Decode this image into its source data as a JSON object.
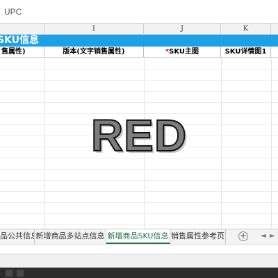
{
  "formula_bar": {
    "text": "UPC"
  },
  "columns": [
    "I",
    "J",
    "K"
  ],
  "banner": {
    "title": "SKU信息"
  },
  "fields": {
    "left_partial": "售属性)",
    "version": "版本(文字销售属性)",
    "sku_main_image_required": "*",
    "sku_main_image": "SKU主图",
    "sku_detail_image": "SKU详情图1"
  },
  "overlay_text": "RED",
  "sheet_tabs": [
    {
      "label": "品公共信息",
      "active": false
    },
    {
      "label": "新增商品多站点信息",
      "active": false
    },
    {
      "label": "新增商品SKU信息",
      "active": true
    },
    {
      "label": "销售属性参考页",
      "active": false
    }
  ],
  "sheet_controls": {
    "add": "+",
    "prev": "◄",
    "next": "►"
  },
  "colors": {
    "banner": "#1aa1e8",
    "active_tab": "#217346",
    "required_mark": "#e60012"
  }
}
